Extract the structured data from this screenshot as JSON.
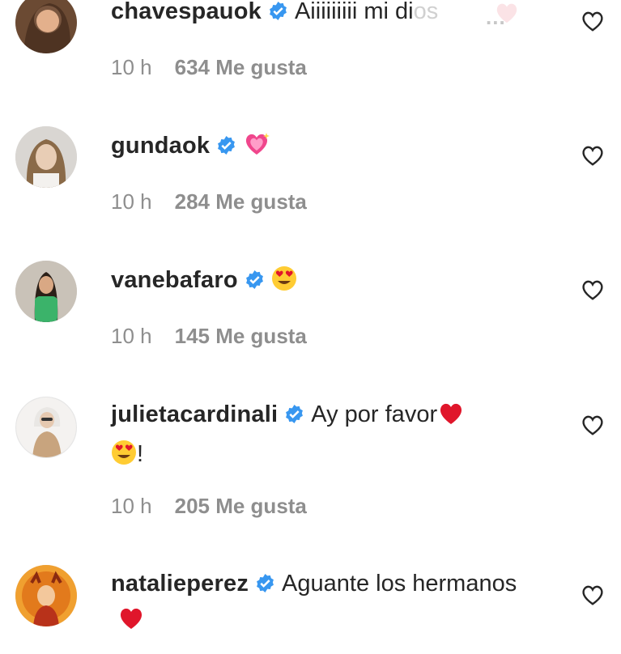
{
  "comments": [
    {
      "username": "chavespauok",
      "text_main": "Aiiiiiiiii mi di",
      "text_faded": "os",
      "time": "10 h",
      "likes": "634 Me gusta",
      "emoji": [
        "light-heart"
      ]
    },
    {
      "username": "gundaok",
      "text_main": "",
      "time": "10 h",
      "likes": "284 Me gusta",
      "emoji": [
        "sparkling-heart"
      ]
    },
    {
      "username": "vanebafaro",
      "text_main": "",
      "time": "10 h",
      "likes": "145 Me gusta",
      "emoji": [
        "heart-eyes"
      ]
    },
    {
      "username": "julietacardinali",
      "text_main": "Ay por favor",
      "text_after": "!",
      "time": "10 h",
      "likes": "205 Me gusta",
      "emoji": [
        "red-heart",
        "heart-eyes"
      ]
    },
    {
      "username": "natalieperez",
      "text_main": "Aguante los hermanos",
      "time": "",
      "likes": "",
      "emoji": [
        "red-heart"
      ]
    }
  ],
  "overflow_indicator": "...",
  "colors": {
    "text": "#262626",
    "meta": "#8e8e8e",
    "verified": "#3897f0",
    "heart_red": "#e0162b"
  }
}
